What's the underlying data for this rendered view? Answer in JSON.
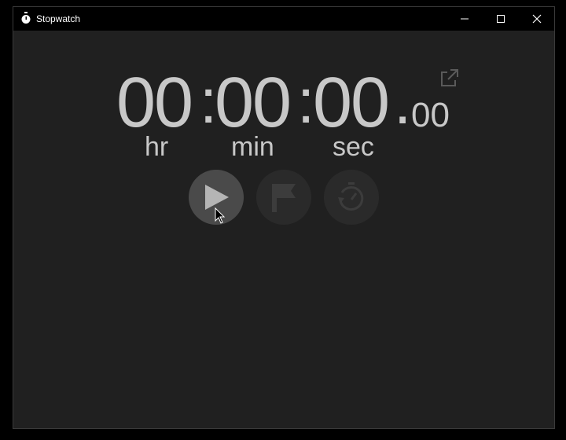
{
  "window": {
    "title": "Stopwatch",
    "controls": [
      "minimize",
      "maximize",
      "close"
    ]
  },
  "timer": {
    "hours": "00",
    "minutes": "00",
    "seconds": "00",
    "separator": ":",
    "decimal": ".",
    "hundredths": "00",
    "unit_labels": {
      "hours": "hr",
      "minutes": "min",
      "seconds": "sec"
    }
  },
  "controls": {
    "start": {
      "icon": "play-icon",
      "enabled": true
    },
    "lap": {
      "icon": "flag-icon",
      "enabled": false
    },
    "reset": {
      "icon": "reset-icon",
      "enabled": false
    },
    "expand": {
      "icon": "expand-icon"
    }
  },
  "colors": {
    "background": "#202020",
    "titlebar": "#000000",
    "digits": "#c8c8c8",
    "active_button": "#4a4a4a",
    "disabled_button": "#2a2a2a"
  }
}
